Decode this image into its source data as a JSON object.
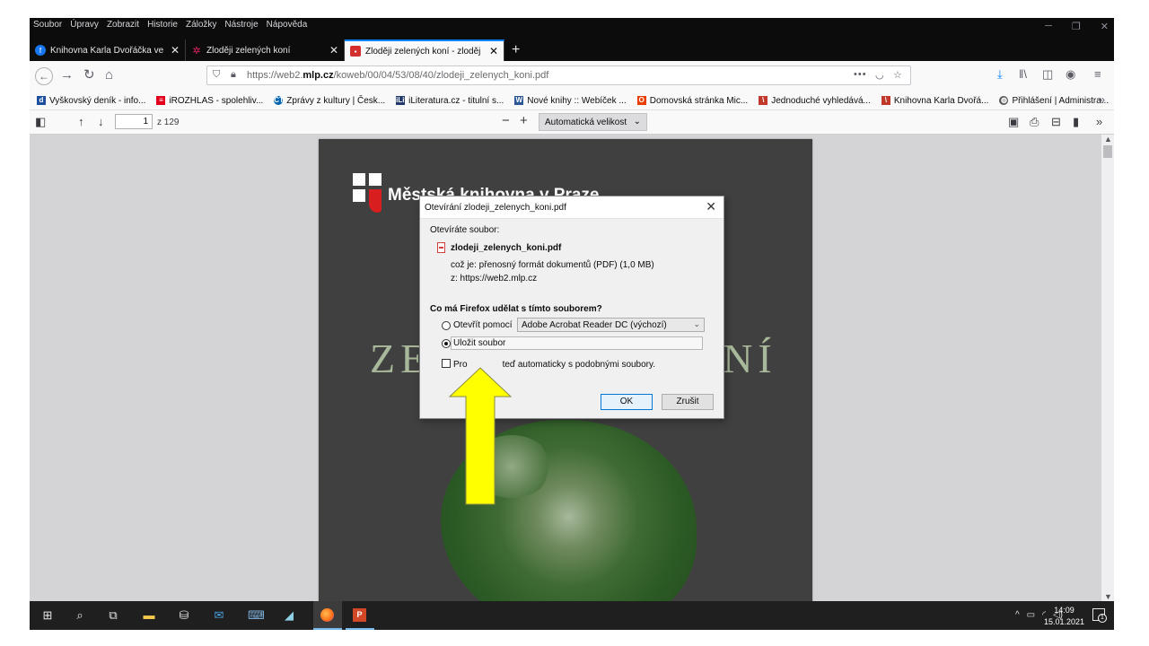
{
  "menu": [
    "Soubor",
    "Úpravy",
    "Zobrazit",
    "Historie",
    "Záložky",
    "Nástroje",
    "Nápověda"
  ],
  "tabs": [
    {
      "title": "Knihovna Karla Dvořáčka ve Vy",
      "favicon": "facebook-icon",
      "color": "#1877f2"
    },
    {
      "title": "Zloději zelených koní",
      "favicon": "star-icon",
      "color": "#e0245e"
    },
    {
      "title": "Zloději zelených koní - zloděj",
      "favicon": "mlp-icon",
      "color": "#d32f2f",
      "active": true
    }
  ],
  "url": {
    "prefix": "https://web2.",
    "domain": "mlp.cz",
    "path": "/koweb/00/04/53/08/40/zlodeji_zelenych_koni.pdf"
  },
  "bookmarks": [
    {
      "label": "Vyškovský deník - info...",
      "icon": "d-icon",
      "color": "#1d4fa0"
    },
    {
      "label": "iROZHLAS - spolehliv...",
      "icon": "irozhlas-icon",
      "color": "#e2001a"
    },
    {
      "label": "Zprávy z kultury | Česk...",
      "icon": "ct-icon",
      "color": "#0064b4"
    },
    {
      "label": "iLiteratura.cz - titulní s...",
      "icon": "ilit-icon",
      "color": "#213a6b"
    },
    {
      "label": "Nové knihy :: Webíček ...",
      "icon": "w-icon",
      "color": "#2b5797"
    },
    {
      "label": "Domovská stránka Mic...",
      "icon": "office-icon",
      "color": "#eb3c00"
    },
    {
      "label": "Jednoduché vyhledává...",
      "icon": "library-icon",
      "color": "#c0392b"
    },
    {
      "label": "Knihovna Karla Dvořá...",
      "icon": "library-icon",
      "color": "#c0392b"
    },
    {
      "label": "Přihlášení | Administra...",
      "icon": "globe-icon",
      "color": "#555555"
    }
  ],
  "pdf": {
    "page": "1",
    "count": "z 129",
    "zoom": "Automatická velikost"
  },
  "document": {
    "logo_text": "Městská knihovna v Praze",
    "title_left": "ZE",
    "title_right": "NÍ"
  },
  "dialog": {
    "title": "Otevírání zlodeji_zelenych_koni.pdf",
    "intro": "Otevíráte soubor:",
    "filename": "zlodeji_zelenych_koni.pdf",
    "type": "což je:  přenosný formát dokumentů (PDF) (1,0 MB)",
    "from": "z:  https://web2.mlp.cz",
    "question": "Co má Firefox udělat s tímto souborem?",
    "open_with": "Otevřít pomocí",
    "app": "Adobe Acrobat Reader DC (výchozí)",
    "save": "Uložit soubor",
    "auto_left": "Pro",
    "auto_right": "teď automaticky s podobnými soubory.",
    "ok": "OK",
    "cancel": "Zrušit"
  },
  "clock": {
    "time": "14:09",
    "date": "15.01.2021"
  },
  "notification_count": "1",
  "colors": {
    "accent": "#0a84ff",
    "arrow": "#ffff00",
    "dark": "#0c0c0d"
  }
}
